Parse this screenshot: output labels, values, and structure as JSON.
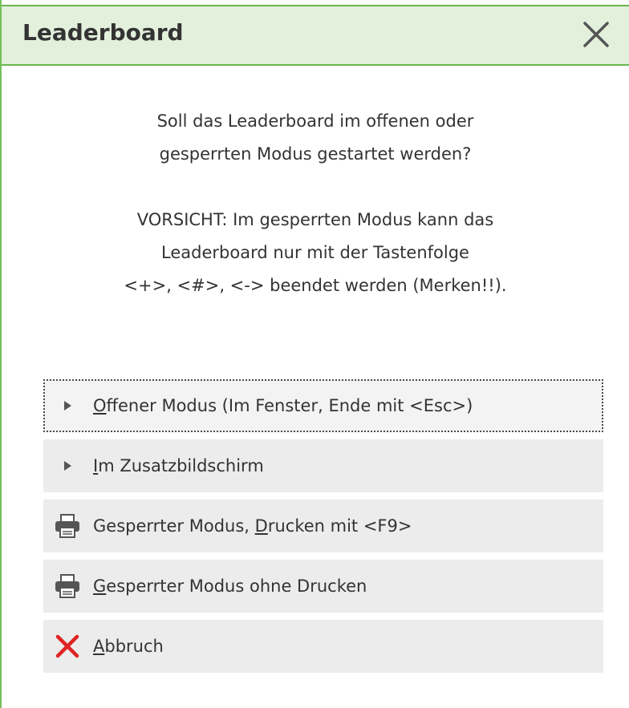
{
  "dialog": {
    "title": "Leaderboard",
    "message_lines": [
      "Soll das Leaderboard im offenen oder",
      "gesperrten Modus gestartet werden?",
      "",
      "VORSICHT: Im gesperrten Modus kann das",
      "Leaderboard nur mit der Tastenfolge",
      "<+>, <#>, <-> beendet werden (Merken!!)."
    ]
  },
  "options": [
    {
      "icon": "triangle-right-icon",
      "pre": "",
      "key": "O",
      "post": "ffener Modus (Im Fenster, Ende mit <Esc>)",
      "focused": true
    },
    {
      "icon": "triangle-right-icon",
      "pre": "",
      "key": "I",
      "post": "m Zusatzbildschirm",
      "focused": false
    },
    {
      "icon": "printer-icon",
      "pre": "Gesperrter Modus, ",
      "key": "D",
      "post": "rucken mit <F9>",
      "focused": false
    },
    {
      "icon": "printer-icon",
      "pre": "",
      "key": "G",
      "post": "esperrter Modus ohne Drucken",
      "focused": false
    },
    {
      "icon": "red-x-icon",
      "pre": "",
      "key": "A",
      "post": "bbruch",
      "focused": false
    }
  ],
  "colors": {
    "title_bar_bg": "#e2f0dc",
    "title_bar_border": "#6ab64f",
    "option_bg": "#ececec",
    "cancel_red": "#e02424"
  }
}
